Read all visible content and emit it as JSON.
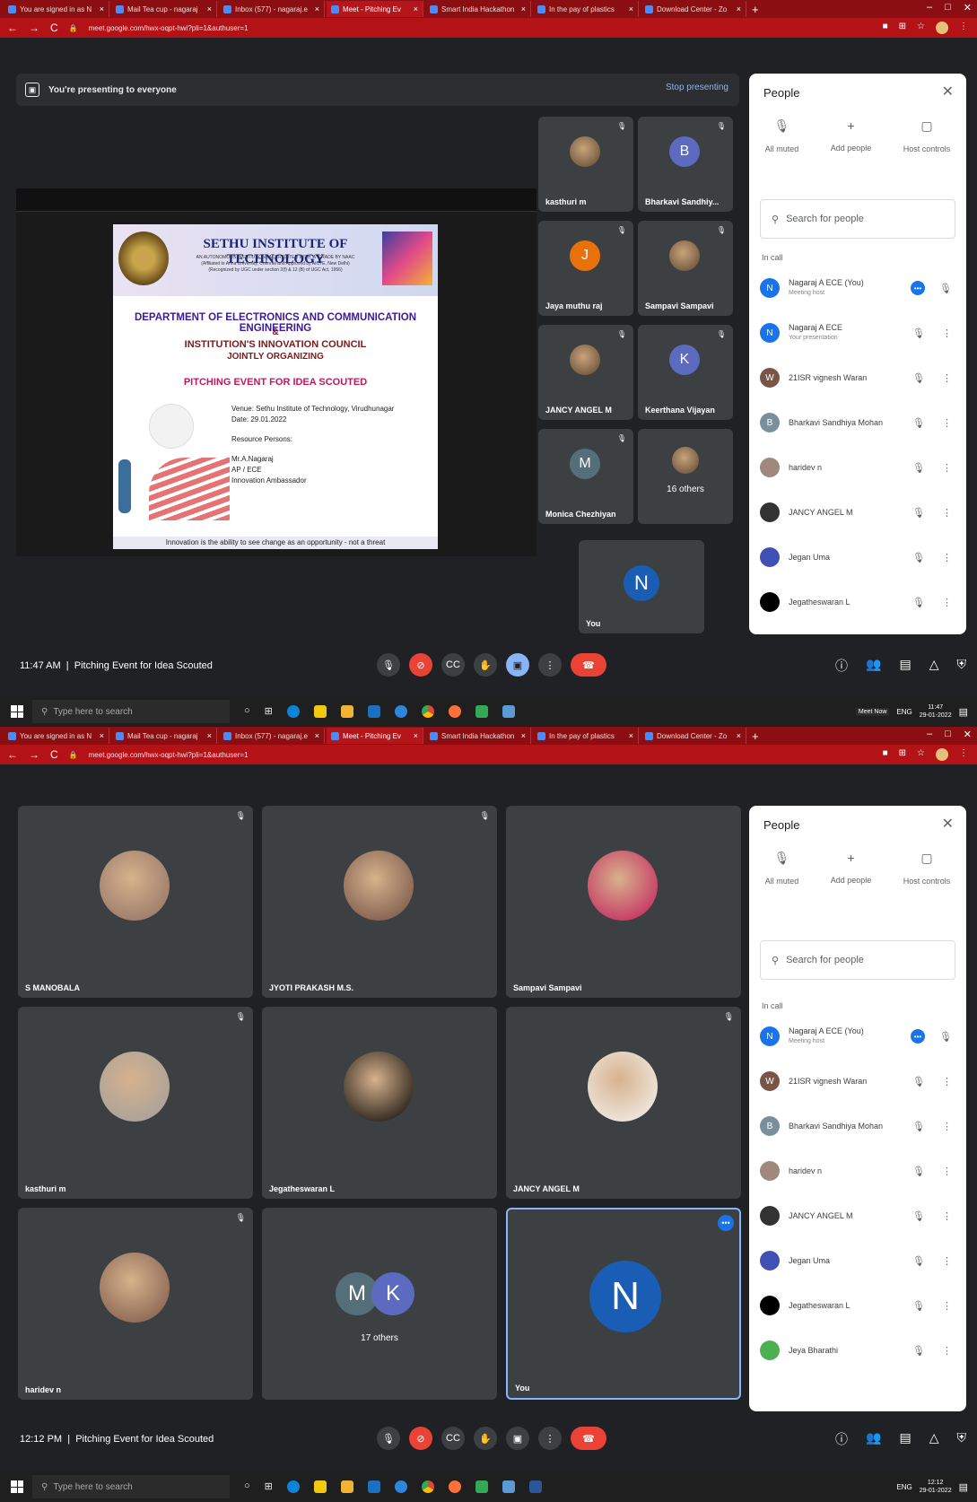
{
  "tabs": [
    {
      "label": "You are signed in as N",
      "active": false
    },
    {
      "label": "Mail Tea cup - nagaraj",
      "active": false
    },
    {
      "label": "Inbox (577) - nagaraj.e",
      "active": false
    },
    {
      "label": "Meet - Pitching Ev",
      "active": true
    },
    {
      "label": "Smart India Hackathon",
      "active": false
    },
    {
      "label": "In the pay of plastics",
      "active": false
    },
    {
      "label": "Download Center - Zo",
      "active": false
    }
  ],
  "url": "meet.google.com/hwx-oqpt-hwi?pli=1&authuser=1",
  "top": {
    "presenting_text": "You're presenting to everyone",
    "stop_presenting": "Stop presenting",
    "slide": {
      "institute": "SETHU INSTITUTE OF TECHNOLOGY",
      "sub1": "AN AUTONOMOUS INSTITUTION | ACCREDITED WITH 'A' GRADE BY NAAC",
      "sub2": "(Affiliated to Anna University, Chennai and Approved by AICTE, New Delhi)",
      "sub3": "(Recognized by UGC under section 2(f) & 12 (B) of UGC Act, 1956)",
      "dept": "DEPARTMENT OF ELECTRONICS AND COMMUNICATION ENGINEERING",
      "amp": "&",
      "iic": "INSTITUTION'S INNOVATION COUNCIL",
      "jointly": "JOINTLY ORGANIZING",
      "event": "PITCHING EVENT FOR IDEA SCOUTED",
      "venue": "Venue: Sethu Institute of Technology, Virudhunagar",
      "date": "Date: 29.01.2022",
      "resource": "Resource Persons:",
      "person": "Mr.A.Nagaraj",
      "role": "AP / ECE",
      "ambassador": "Innovation Ambassador",
      "footer": "Innovation is the ability to see change as an opportunity - not a threat"
    },
    "tiles": [
      {
        "name": "kasthuri m",
        "kind": "photo",
        "letter": ""
      },
      {
        "name": "Bharkavi Sandhiy...",
        "kind": "letter",
        "letter": "B",
        "color": "#5c6bc0"
      },
      {
        "name": "Jaya muthu raj",
        "kind": "letter",
        "letter": "J",
        "color": "#e8710a"
      },
      {
        "name": "Sampavi Sampavi",
        "kind": "photo",
        "letter": ""
      },
      {
        "name": "JANCY ANGEL M",
        "kind": "photo",
        "letter": ""
      },
      {
        "name": "Keerthana Vijayan",
        "kind": "letter",
        "letter": "K",
        "color": "#5c6bc0"
      },
      {
        "name": "Monica Chezhiyan",
        "kind": "letter",
        "letter": "M",
        "color": "#546e7a"
      },
      {
        "name": "16 others",
        "kind": "others",
        "letter": ""
      }
    ],
    "you_label": "You",
    "you_letter": "N",
    "time": "11:47 AM",
    "meeting": "Pitching Event for Idea Scouted",
    "people": [
      {
        "name": "Nagaraj A ECE (You)",
        "sub": "Meeting host",
        "letter": "N",
        "color": "#1a73e8"
      },
      {
        "name": "Nagaraj A ECE",
        "sub": "Your presentation",
        "letter": "N",
        "color": "#1a73e8"
      },
      {
        "name": "21ISR vignesh Waran",
        "sub": "",
        "letter": "W",
        "color": "#795548"
      },
      {
        "name": "Bharkavi Sandhiya Mohan",
        "sub": "",
        "letter": "B",
        "color": "#78909c"
      },
      {
        "name": "haridev n",
        "sub": "",
        "letter": "",
        "color": "#a1887f"
      },
      {
        "name": "JANCY ANGEL M",
        "sub": "",
        "letter": "",
        "color": "#333333"
      },
      {
        "name": "Jegan Uma",
        "sub": "",
        "letter": "",
        "color": "#3f51b5"
      },
      {
        "name": "Jegatheswaran L",
        "sub": "",
        "letter": "",
        "color": "#000000"
      }
    ],
    "clock_time": "11:47",
    "clock_date": "29-01-2022"
  },
  "bottom": {
    "tiles": [
      {
        "name": "S MANOBALA"
      },
      {
        "name": "JYOTI PRAKASH M.S."
      },
      {
        "name": "Sampavi Sampavi"
      },
      {
        "name": "kasthuri m"
      },
      {
        "name": "Jegatheswaran L"
      },
      {
        "name": "JANCY ANGEL M"
      },
      {
        "name": "haridev n"
      }
    ],
    "others_label": "17 others",
    "others_letters": [
      "M",
      "K"
    ],
    "you_label": "You",
    "you_letter": "N",
    "time": "12:12 PM",
    "meeting": "Pitching Event for Idea Scouted",
    "people": [
      {
        "name": "Nagaraj A ECE (You)",
        "sub": "Meeting host",
        "letter": "N",
        "color": "#1a73e8"
      },
      {
        "name": "21ISR vignesh Waran",
        "sub": "",
        "letter": "W",
        "color": "#795548"
      },
      {
        "name": "Bharkavi Sandhiya Mohan",
        "sub": "",
        "letter": "B",
        "color": "#78909c"
      },
      {
        "name": "haridev n",
        "sub": "",
        "letter": "",
        "color": "#a1887f"
      },
      {
        "name": "JANCY ANGEL M",
        "sub": "",
        "letter": "",
        "color": "#333333"
      },
      {
        "name": "Jegan Uma",
        "sub": "",
        "letter": "",
        "color": "#3f51b5"
      },
      {
        "name": "Jegatheswaran L",
        "sub": "",
        "letter": "",
        "color": "#000000"
      },
      {
        "name": "Jeya Bharathi",
        "sub": "",
        "letter": "",
        "color": "#4caf50"
      }
    ],
    "clock_time": "12:12",
    "clock_date": "29-01-2022"
  },
  "people_panel": {
    "title": "People",
    "all_muted": "All muted",
    "add_people": "Add people",
    "host_controls": "Host controls",
    "search_placeholder": "Search for people",
    "in_call": "In call"
  },
  "taskbar": {
    "search_placeholder": "Type here to search",
    "lang": "ENG",
    "tooltip": "Meet Now"
  },
  "icons": {
    "mic": "mic-icon",
    "camera_off": "camera-off-icon",
    "captions": "captions-icon",
    "hand": "raise-hand-icon",
    "present": "present-icon",
    "more": "more-icon",
    "end": "end-call-icon",
    "info": "info-icon",
    "people": "people-icon",
    "chat": "chat-icon",
    "activities": "activities-icon",
    "shield": "shield-icon"
  },
  "colors": {
    "meet_bg": "#202124",
    "tile_bg": "#3c4043",
    "end_call": "#ea4335",
    "browser_frame": "#b31217",
    "accent": "#1a73e8"
  }
}
